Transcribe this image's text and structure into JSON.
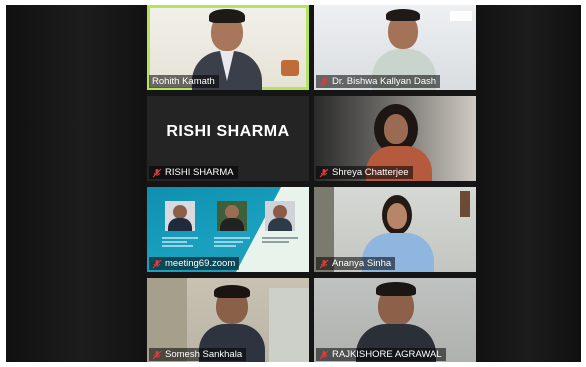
{
  "participants": [
    {
      "name": "Rohith Kamath",
      "active": true
    },
    {
      "name": "Dr. Bishwa Kallyan Dash",
      "active": false
    },
    {
      "name": "RISHI SHARMA",
      "card_text": "RISHI SHARMA",
      "active": false
    },
    {
      "name": "Shreya Chatterjee",
      "active": false
    },
    {
      "name": "meeting69.zoom",
      "active": false
    },
    {
      "name": "Ananya Sinha",
      "active": false
    },
    {
      "name": "Somesh Sankhala",
      "active": false
    },
    {
      "name": "RAJKISHORE AGRAWAL",
      "active": false
    }
  ],
  "icons": {
    "muted": "mic-muted-icon"
  },
  "colors": {
    "active_speaker_border": "#b7e35a",
    "muted_icon": "#e03a3a"
  }
}
